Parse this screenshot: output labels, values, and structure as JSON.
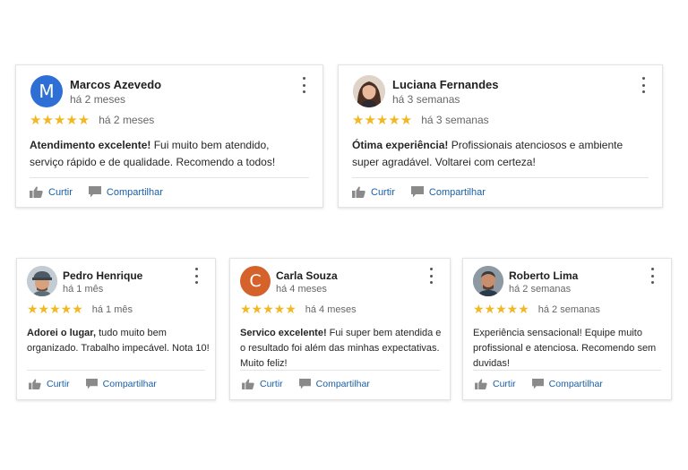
{
  "colors": {
    "star": "#f2b824",
    "link": "#1a5fa6",
    "avatar_marcos": "#2d6fd4",
    "avatar_carla": "#d4622a"
  },
  "reviews": [
    {
      "name": "Marcos Azevedo",
      "time": "há 2 meses",
      "stars": "★★★★★",
      "rating_date": "há 2 meses",
      "highlight": "Atendimento excelente!",
      "text": " Fui muito bem atendido, serviço rápido e de qualidade. Recomendo a todos!",
      "avatar_letter": "M",
      "like": "Curtir",
      "share": "Compartilhar"
    },
    {
      "name": "Luciana Fernandes",
      "time": "há 3 semanas",
      "stars": "★★★★★",
      "rating_date": "há 3 semanas",
      "highlight": "Ótima experiência!",
      "text": " Profissionais atenciosos e ambiente super agradável. Voltarei com certeza!",
      "avatar_icon": "woman-portrait-icon",
      "like": "Curtir",
      "share": "Compartilhar"
    },
    {
      "name": "Pedro Henrique",
      "time": "há 1 mês",
      "stars": "★★★★★",
      "rating_date": "há 1 mês",
      "highlight": "Adorei o lugar,",
      "text": " tudo muito bem organizado. Trabalho impecável. Nota 10!",
      "avatar_icon": "man-cap-portrait-icon",
      "like": "Curtir",
      "share": "Compartilhar"
    },
    {
      "name": "Carla Souza",
      "time": "há 4 meses",
      "stars": "★★★★★",
      "rating_date": "há 4 meses",
      "highlight": "Servico excelente!",
      "text": " Fui super bem atendida e o resultado foi além das minhas expectativas. Muito feliz!",
      "avatar_letter": "C",
      "like": "Curtir",
      "share": "Compartilhar"
    },
    {
      "name": "Roberto Lima",
      "time": "há 2 semanas",
      "stars": "★★★★★",
      "rating_date": "há 2 semanas",
      "highlight": "",
      "text": "Experiência sensacional! Equipe muito profissional e atenciosa. Recomendo sem duvidas!",
      "avatar_icon": "man-portrait-icon",
      "like": "Curtir",
      "share": "Compartilhar"
    }
  ]
}
